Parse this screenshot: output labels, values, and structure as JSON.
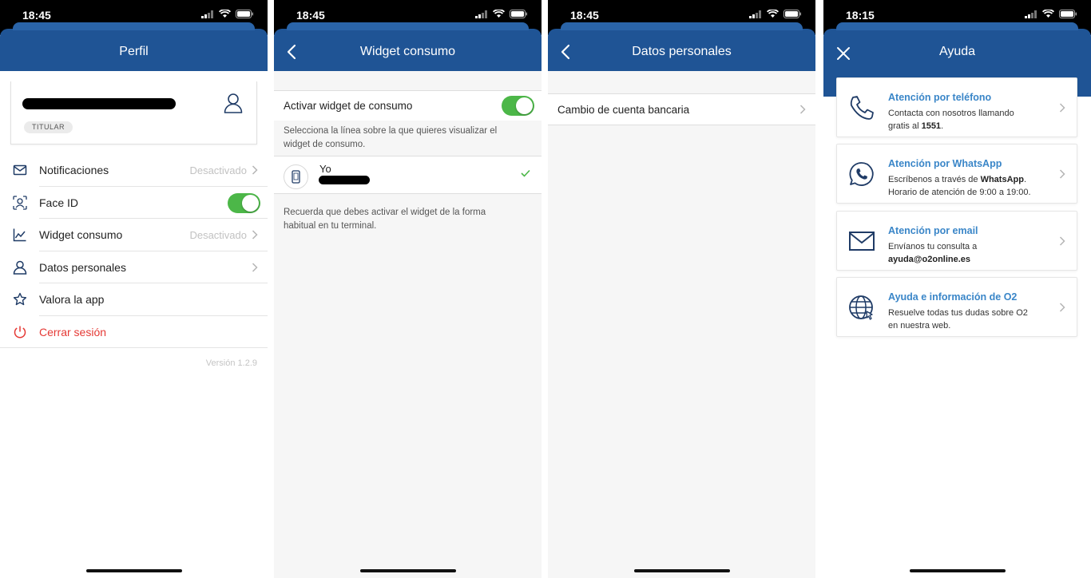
{
  "screens": {
    "profile": {
      "time": "18:45",
      "title": "Perfil",
      "badge": "TITULAR",
      "items": [
        {
          "label": "Notificaciones",
          "value": "Desactivado"
        },
        {
          "label": "Face ID"
        },
        {
          "label": "Widget consumo",
          "value": "Desactivado"
        },
        {
          "label": "Datos personales"
        },
        {
          "label": "Valora la app"
        },
        {
          "label": "Cerrar sesión"
        }
      ],
      "version": "Versión 1.2.9",
      "face_id_enabled": true
    },
    "widget": {
      "time": "18:45",
      "title": "Widget consumo",
      "toggle_label": "Activar widget de consumo",
      "toggle_enabled": true,
      "select_text": "Selecciona la línea sobre la que quieres visualizar el widget de consumo.",
      "line_name": "Yo",
      "note": "Recuerda que debes activar el widget de la forma habitual en tu terminal."
    },
    "datos": {
      "time": "18:45",
      "title": "Datos personales",
      "item": "Cambio de cuenta bancaria"
    },
    "ayuda": {
      "time": "18:15",
      "title": "Ayuda",
      "cards": [
        {
          "title": "Atención por teléfono",
          "line1": "Contacta con nosotros llamando",
          "line2_pre": "gratis al ",
          "line2_bold": "1551",
          "line2_post": "."
        },
        {
          "title": "Atención por WhatsApp",
          "line1_pre": "Escríbenos a través de ",
          "line1_bold": "WhatsApp",
          "line1_post": ".",
          "line2": "Horario de atención de 9:00 a 19:00."
        },
        {
          "title": "Atención por email",
          "line1": "Envíanos tu consulta a",
          "line2_bold": "ayuda@o2online.es"
        },
        {
          "title": "Ayuda e información de O2",
          "line1": "Resuelve todas tus dudas sobre O2",
          "line2": "en nuestra web."
        }
      ]
    }
  },
  "colors": {
    "nav_blue": "#1f5495",
    "toggle_green": "#4cb748",
    "link_blue": "#3a86c8",
    "logout_red": "#e53935"
  }
}
